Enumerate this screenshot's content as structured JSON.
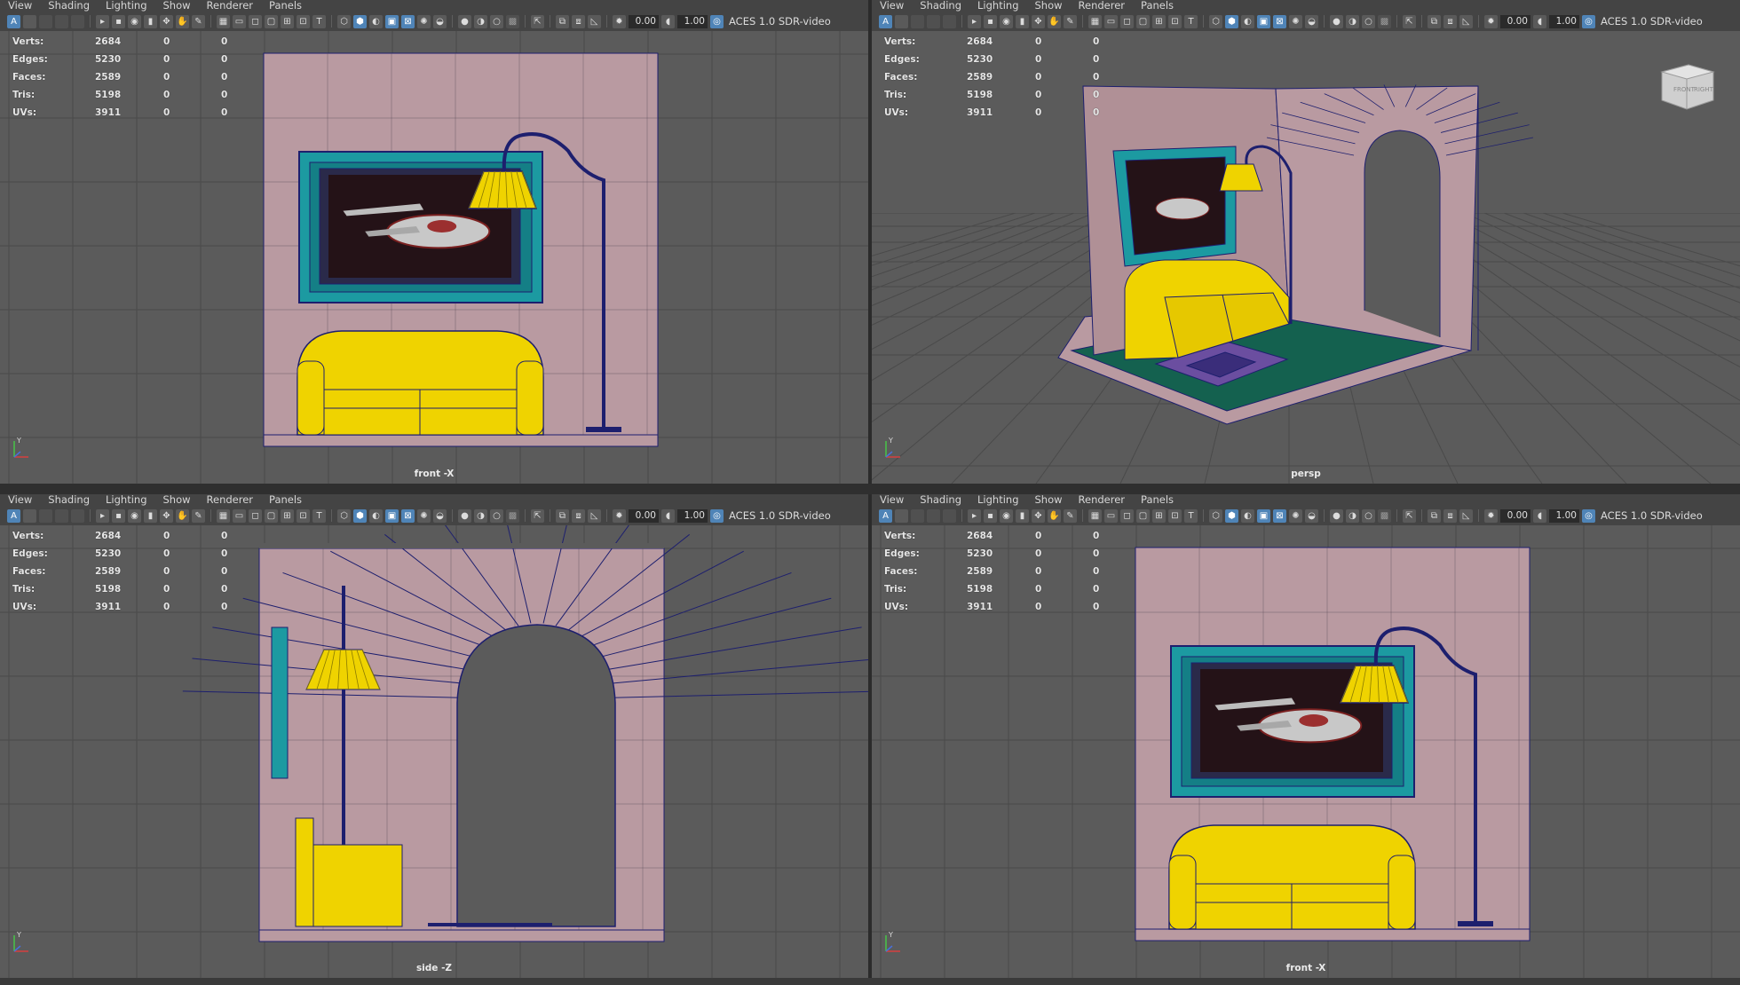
{
  "menu": [
    "View",
    "Shading",
    "Lighting",
    "Show",
    "Renderer",
    "Panels"
  ],
  "toolbar": {
    "exposure_value": "0.00",
    "gamma_value": "1.00",
    "color_space": "ACES 1.0 SDR-video"
  },
  "hud": {
    "stats": [
      {
        "label": "Verts:",
        "v1": "2684",
        "v2": "0",
        "v3": "0"
      },
      {
        "label": "Edges:",
        "v1": "5230",
        "v2": "0",
        "v3": "0"
      },
      {
        "label": "Faces:",
        "v1": "2589",
        "v2": "0",
        "v3": "0"
      },
      {
        "label": "Tris:",
        "v1": "5198",
        "v2": "0",
        "v3": "0"
      },
      {
        "label": "UVs:",
        "v1": "3911",
        "v2": "0",
        "v3": "0"
      }
    ]
  },
  "panels": [
    {
      "id": "top-left",
      "camera": "front -X",
      "active": false
    },
    {
      "id": "top-right",
      "camera": "persp",
      "active": true
    },
    {
      "id": "bottom-left",
      "camera": "side -Z",
      "active": false
    },
    {
      "id": "bottom-right",
      "camera": "front -X",
      "active": false
    }
  ],
  "view_cube": {
    "front": "FRONT",
    "right": "RIGHT"
  },
  "axis": {
    "y": "Y"
  },
  "colors": {
    "viewport_bg": "#5b5b5b",
    "grid_line": "#4a4a4a",
    "wall": "#b99aa1",
    "wire": "#1d1f6e",
    "sofa": "#efd300",
    "frame": "#1c9aa1",
    "floor": "#14614f",
    "rug": "#5a3b8a"
  }
}
